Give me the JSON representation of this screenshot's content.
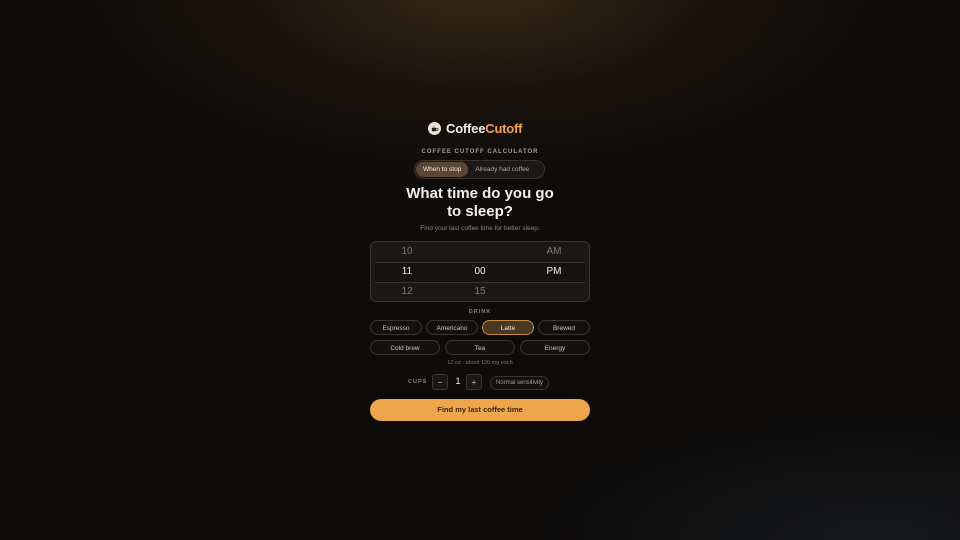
{
  "brand": {
    "name_part1": "Coffee",
    "name_part2": "Cutoff"
  },
  "eyebrow": "COFFEE CUTOFF CALCULATOR",
  "mode_tabs": [
    {
      "label": "When to stop",
      "active": true
    },
    {
      "label": "Already had coffee",
      "active": false
    }
  ],
  "heading": {
    "line1": "What time do you go",
    "line2": "to sleep?"
  },
  "subheading": "Find your last coffee time for better sleep.",
  "time_picker": {
    "hour": {
      "prev": "10",
      "selected": "11",
      "next": "12"
    },
    "minute": {
      "prev": "",
      "selected": "00",
      "next": "15"
    },
    "period": {
      "prev": "AM",
      "selected": "PM",
      "next": ""
    }
  },
  "drink": {
    "label": "DRINK",
    "options_row1": [
      "Espresso",
      "Americano",
      "Latte",
      "Brewed"
    ],
    "options_row2": [
      "Cold brew",
      "Tea",
      "Energy"
    ],
    "selected": "Latte",
    "serving_note": "12 oz · about 120 mg each"
  },
  "cups": {
    "label": "CUPS",
    "decrement": "−",
    "value": "1",
    "increment": "+",
    "sensitivity": "Normal sensitivity"
  },
  "cta_label": "Find my last coffee time",
  "colors": {
    "accent": "#eea64b",
    "background": "#0d0c0b",
    "active_chip": "#4a3824"
  }
}
